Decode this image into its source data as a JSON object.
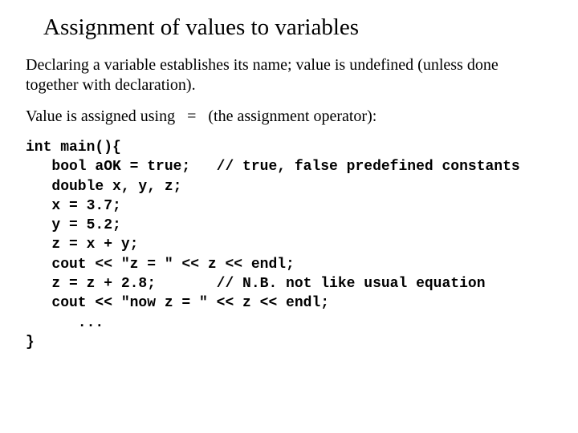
{
  "title": "Assignment of values to variables",
  "para1": "Declaring a variable establishes its name; value is undefined (unless done together with declaration).",
  "para2_pre": "Value is assigned using",
  "para2_op": "=",
  "para2_post": "(the assignment operator):",
  "code": "int main(){\n   bool aOK = true;   // true, false predefined constants\n   double x, y, z;\n   x = 3.7;\n   y = 5.2;\n   z = x + y;\n   cout << \"z = \" << z << endl;\n   z = z + 2.8;       // N.B. not like usual equation\n   cout << \"now z = \" << z << endl;\n      ...\n}"
}
